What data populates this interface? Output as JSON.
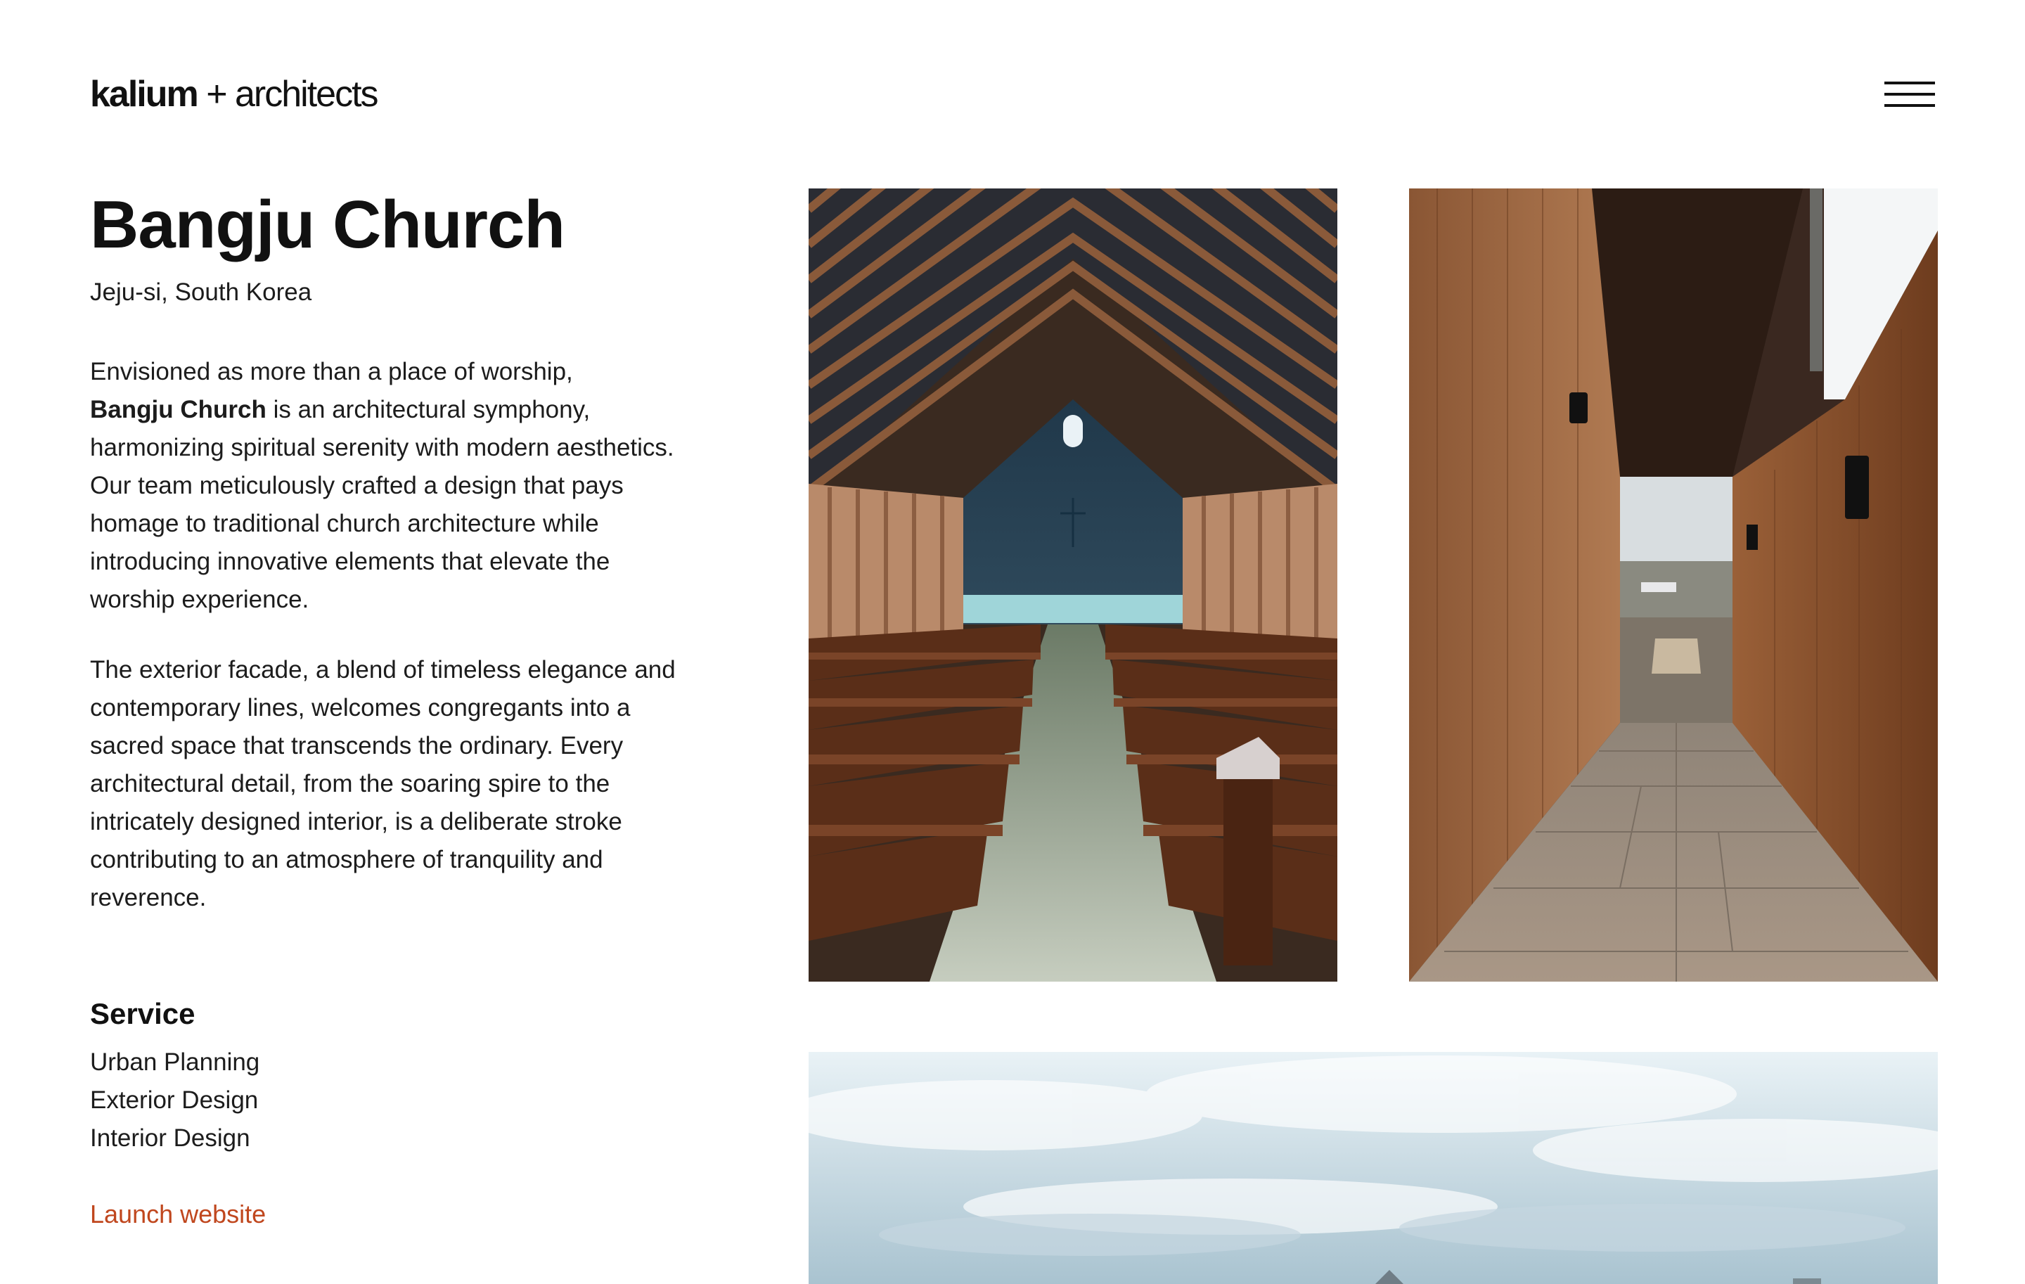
{
  "header": {
    "logo_primary": "kalium",
    "logo_secondary": "+ architects",
    "menu_icon": "hamburger-menu-icon"
  },
  "project": {
    "title": "Bangju Church",
    "location": "Jeju-si, South Korea",
    "paragraph1_start": "Envisioned as more than a place of worship,",
    "paragraph1_bold": "Bangju Church",
    "paragraph1_rest": "is an architectural symphony, harmonizing spiritual serenity with modern aesthetics. Our team meticulously crafted a design that pays homage to traditional church architecture while introducing innovative elements that elevate the worship experience.",
    "paragraph2": "The exterior facade, a blend of timeless elegance and contemporary lines, welcomes congregants into a sacred space that transcends the ordinary. Every architectural detail, from the soaring spire to the intricately designed interior, is a deliberate stroke contributing to an atmosphere of tranquility and reverence."
  },
  "service": {
    "heading": "Service",
    "items": [
      "Urban Planning",
      "Exterior Design",
      "Interior Design"
    ]
  },
  "launch_link": "Launch website",
  "gallery": {
    "images": [
      "church-interior-photo",
      "wooden-corridor-photo",
      "church-exterior-sky-photo"
    ]
  },
  "colors": {
    "link": "#c0471e",
    "text": "#1a1a1a",
    "background": "#ffffff"
  }
}
